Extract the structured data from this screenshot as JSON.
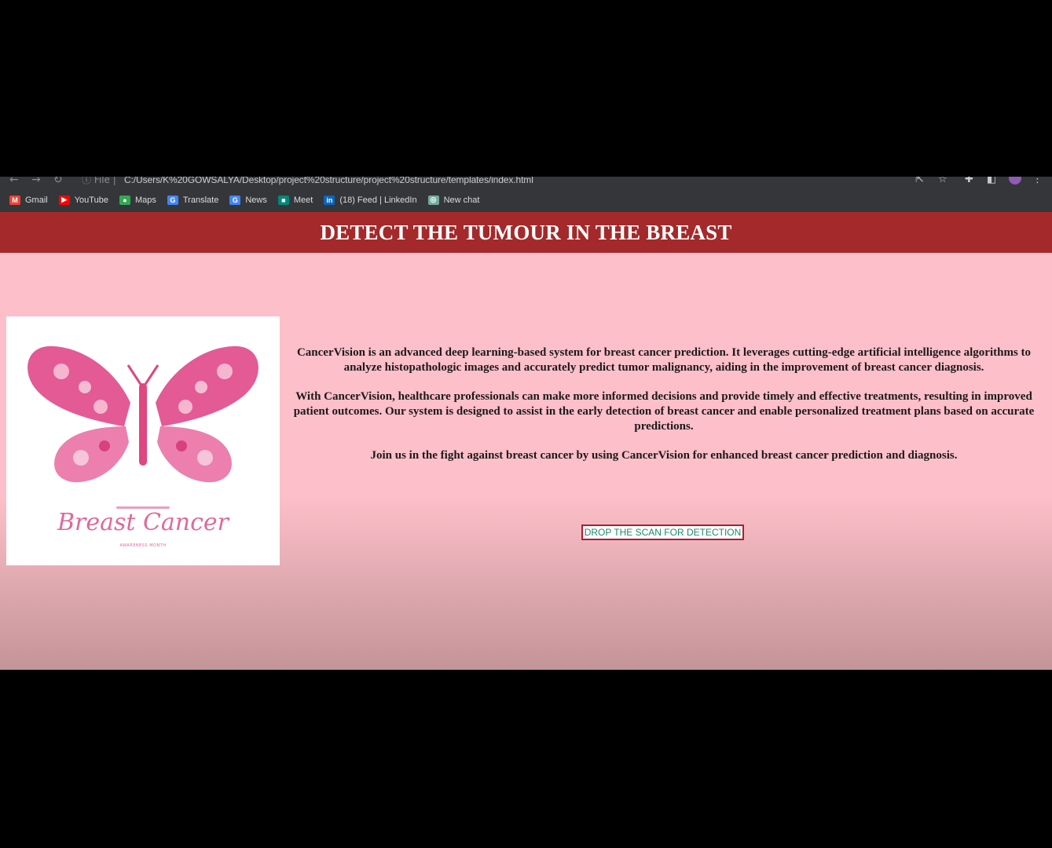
{
  "browser": {
    "url_scheme": "File",
    "url": "C:/Users/K%20GOWSALYA/Desktop/project%20structure/project%20structure/templates/index.html",
    "bookmarks": [
      {
        "label": "Gmail",
        "icon": "gmail-icon",
        "color": "#ea4335",
        "glyph": "M"
      },
      {
        "label": "YouTube",
        "icon": "youtube-icon",
        "color": "#ff0000",
        "glyph": "▶"
      },
      {
        "label": "Maps",
        "icon": "maps-icon",
        "color": "#34a853",
        "glyph": "●"
      },
      {
        "label": "Translate",
        "icon": "translate-icon",
        "color": "#4285f4",
        "glyph": "G"
      },
      {
        "label": "News",
        "icon": "news-icon",
        "color": "#4285f4",
        "glyph": "G"
      },
      {
        "label": "Meet",
        "icon": "meet-icon",
        "color": "#00897b",
        "glyph": "■"
      },
      {
        "label": "(18) Feed | LinkedIn",
        "icon": "linkedin-icon",
        "color": "#0a66c2",
        "glyph": "in"
      },
      {
        "label": "New chat",
        "icon": "chat-icon",
        "color": "#74aa9c",
        "glyph": "◎"
      }
    ]
  },
  "page": {
    "title": "DETECT THE TUMOUR IN THE BREAST",
    "image": {
      "caption": "Breast Cancer",
      "subcaption": "AWARENESS MONTH"
    },
    "paragraphs": [
      "CancerVision is an advanced deep learning-based system for breast cancer prediction. It leverages cutting-edge artificial intelligence algorithms to analyze histopathologic images and accurately predict tumor malignancy, aiding in the improvement of breast cancer diagnosis.",
      "With CancerVision, healthcare professionals can make more informed decisions and provide timely and effective treatments, resulting in improved patient outcomes. Our system is designed to assist in the early detection of breast cancer and enable personalized treatment plans based on accurate predictions.",
      "Join us in the fight against breast cancer by using CancerVision for enhanced breast cancer prediction and diagnosis."
    ],
    "drop_button_label": "DROP THE SCAN FOR DETECTION"
  },
  "colors": {
    "header_bg": "#a3292b",
    "page_bg": "#fdbfc9",
    "button_border": "#b01c2a",
    "button_text": "#1c8a6e"
  }
}
